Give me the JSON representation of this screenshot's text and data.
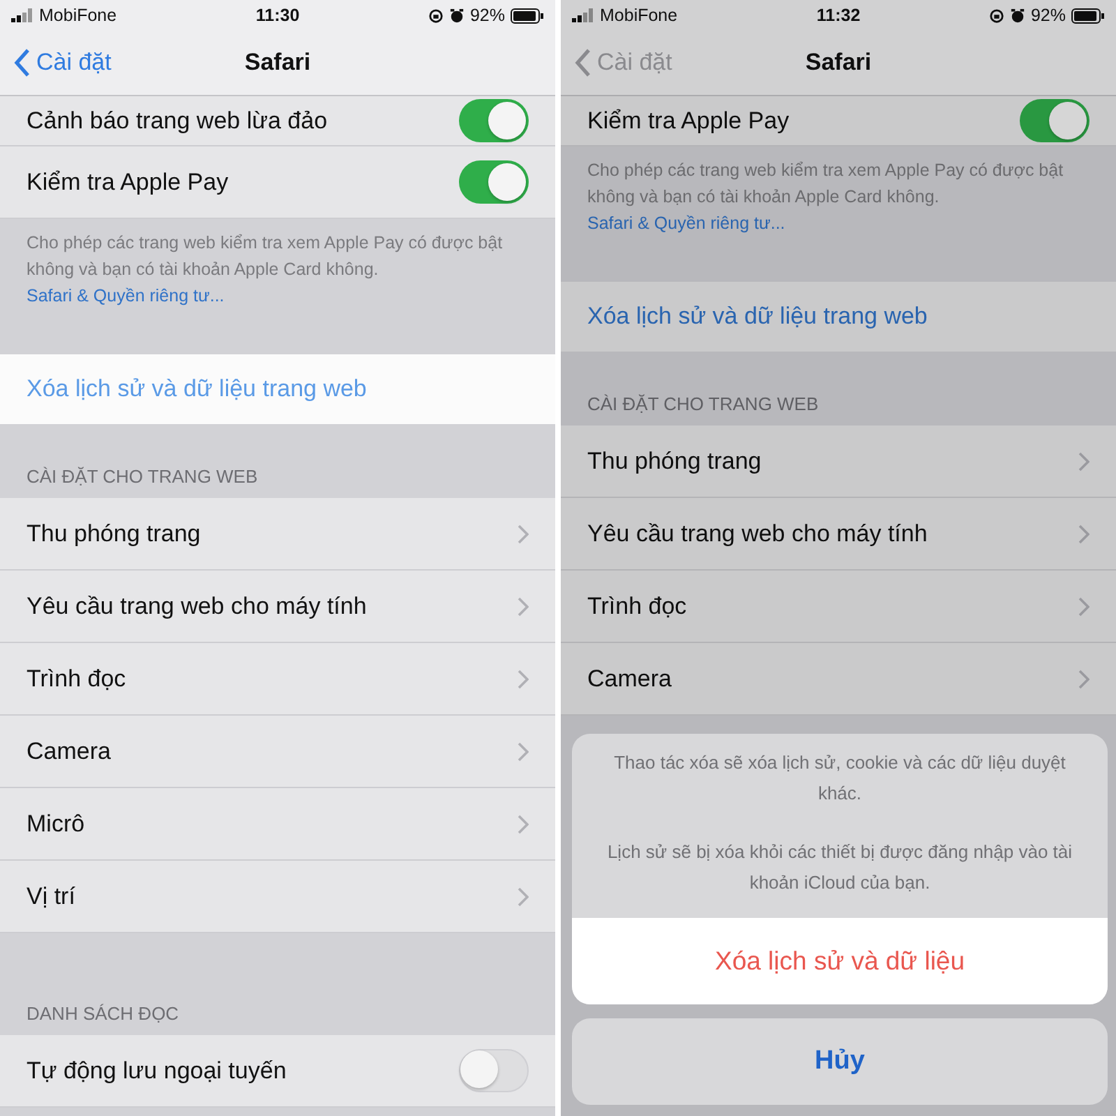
{
  "screens": [
    {
      "status_bar": {
        "carrier": "MobiFone",
        "time": "11:30",
        "battery": "92%"
      },
      "nav": {
        "back": "Cài đặt",
        "back_enabled": true,
        "title": "Safari"
      },
      "groups": [
        {
          "rows": [
            {
              "kind": "toggle",
              "label": "Cảnh báo trang web lừa đảo",
              "on": true
            },
            {
              "kind": "toggle",
              "label": "Kiểm tra Apple Pay",
              "on": true
            }
          ],
          "footer": "Cho phép các trang web kiểm tra xem Apple Pay có được bật không và bạn có tài khoản Apple Card không.",
          "footer_link": "Safari & Quyền riêng tư..."
        },
        {
          "rows": [
            {
              "kind": "action",
              "label": "Xóa lịch sử và dữ liệu trang web",
              "highlighted": true
            }
          ]
        },
        {
          "header": "CÀI ĐẶT CHO TRANG WEB",
          "rows": [
            {
              "kind": "disclosure",
              "label": "Thu phóng trang"
            },
            {
              "kind": "disclosure",
              "label": "Yêu cầu trang web cho máy tính"
            },
            {
              "kind": "disclosure",
              "label": "Trình đọc"
            },
            {
              "kind": "disclosure",
              "label": "Camera"
            },
            {
              "kind": "disclosure",
              "label": "Micrô"
            },
            {
              "kind": "disclosure",
              "label": "Vị trí"
            }
          ]
        },
        {
          "header": "DANH SÁCH ĐỌC",
          "rows": [
            {
              "kind": "toggle",
              "label": "Tự động lưu ngoại tuyến",
              "on": false
            }
          ]
        }
      ]
    },
    {
      "status_bar": {
        "carrier": "MobiFone",
        "time": "11:32",
        "battery": "92%"
      },
      "nav": {
        "back": "Cài đặt",
        "back_enabled": false,
        "title": "Safari"
      },
      "groups": [
        {
          "rows": [
            {
              "kind": "toggle",
              "label": "Kiểm tra Apple Pay",
              "on": true
            }
          ],
          "footer": "Cho phép các trang web kiểm tra xem Apple Pay có được bật không và bạn có tài khoản Apple Card không.",
          "footer_link": "Safari & Quyền riêng tư..."
        },
        {
          "rows": [
            {
              "kind": "action",
              "label": "Xóa lịch sử và dữ liệu trang web",
              "highlighted": false
            }
          ]
        },
        {
          "header": "CÀI ĐẶT CHO TRANG WEB",
          "rows": [
            {
              "kind": "disclosure",
              "label": "Thu phóng trang"
            },
            {
              "kind": "disclosure",
              "label": "Yêu cầu trang web cho máy tính"
            },
            {
              "kind": "disclosure",
              "label": "Trình đọc"
            },
            {
              "kind": "disclosure",
              "label": "Camera"
            }
          ]
        }
      ],
      "action_sheet": {
        "messages": [
          "Thao tác xóa sẽ xóa lịch sử, cookie và các dữ liệu duyệt khác.",
          "Lịch sử sẽ bị xóa khỏi các thiết bị được đăng nhập vào tài khoản iCloud của bạn."
        ],
        "destructive": "Xóa lịch sử và dữ liệu",
        "cancel": "Hủy"
      }
    }
  ]
}
